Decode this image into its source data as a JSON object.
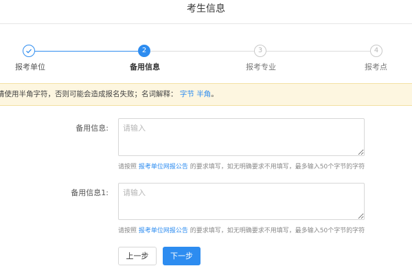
{
  "page": {
    "title": "考生信息"
  },
  "steps": [
    {
      "label": "报考单位",
      "number": "",
      "status": "done",
      "icon": "check-icon"
    },
    {
      "label": "备用信息",
      "number": "2",
      "status": "active"
    },
    {
      "label": "报考专业",
      "number": "3",
      "status": "pending"
    },
    {
      "label": "报考点",
      "number": "4",
      "status": "pending"
    }
  ],
  "notice": {
    "text": "请使用半角字符，否则可能会造成报名失败；名词解释：",
    "link1": "字节",
    "link2": "半角",
    "end": "。"
  },
  "fields": [
    {
      "label": "备用信息:",
      "placeholder": "请输入",
      "value": "",
      "hint_prefix": "请按照",
      "hint_link": "报考单位网报公告",
      "hint_suffix": "的要求填写，如无明确要求不用填写，最多输入50个字节的字符"
    },
    {
      "label": "备用信息1:",
      "placeholder": "请输入",
      "value": "",
      "hint_prefix": "请按照",
      "hint_link": "报考单位网报公告",
      "hint_suffix": "的要求填写，如无明确要求不用填写，最多输入50个字节的字符"
    }
  ],
  "buttons": {
    "prev": "上一步",
    "next": "下一步"
  },
  "colors": {
    "primary": "#2d8cf0",
    "notice_bg": "#fdf6e0",
    "notice_border": "#f3e0a2"
  }
}
